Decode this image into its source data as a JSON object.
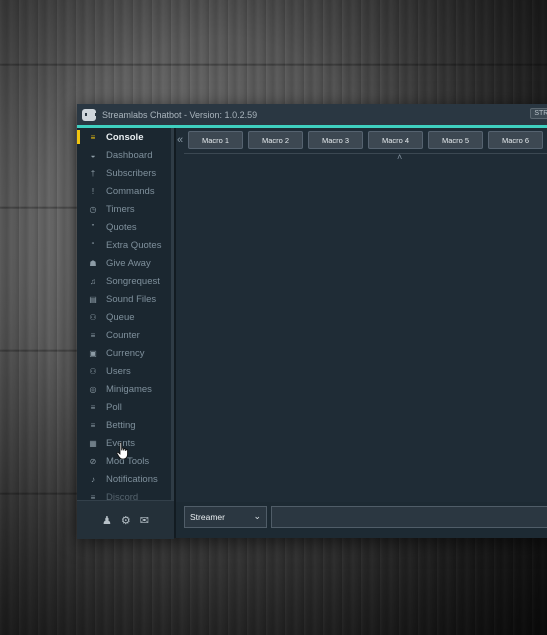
{
  "window": {
    "title": "Streamlabs Chatbot - Version: 1.0.2.59",
    "corner_badge": "STRE"
  },
  "sidebar": {
    "items": [
      {
        "label": "Console",
        "icon": "list-icon",
        "glyph": "≡",
        "active": true
      },
      {
        "label": "Dashboard",
        "icon": "dashboard-icon",
        "glyph": "◒"
      },
      {
        "label": "Subscribers",
        "icon": "person-icon",
        "glyph": "†"
      },
      {
        "label": "Commands",
        "icon": "exclamation-icon",
        "glyph": "!"
      },
      {
        "label": "Timers",
        "icon": "clock-icon",
        "glyph": "◷"
      },
      {
        "label": "Quotes",
        "icon": "quote-close-icon",
        "glyph": "”"
      },
      {
        "label": "Extra Quotes",
        "icon": "quote-open-icon",
        "glyph": "“"
      },
      {
        "label": "Give Away",
        "icon": "gift-icon",
        "glyph": "☗"
      },
      {
        "label": "Songrequest",
        "icon": "music-icon",
        "glyph": "♫"
      },
      {
        "label": "Sound Files",
        "icon": "file-audio-icon",
        "glyph": "▤"
      },
      {
        "label": "Queue",
        "icon": "users-icon",
        "glyph": "⚇"
      },
      {
        "label": "Counter",
        "icon": "list-icon",
        "glyph": "≡"
      },
      {
        "label": "Currency",
        "icon": "money-icon",
        "glyph": "▣"
      },
      {
        "label": "Users",
        "icon": "users-icon",
        "glyph": "⚇"
      },
      {
        "label": "Minigames",
        "icon": "gamepad-icon",
        "glyph": "◎"
      },
      {
        "label": "Poll",
        "icon": "list-icon",
        "glyph": "≡"
      },
      {
        "label": "Betting",
        "icon": "list-icon",
        "glyph": "≡"
      },
      {
        "label": "Events",
        "icon": "calendar-icon",
        "glyph": "▦"
      },
      {
        "label": "Mod Tools",
        "icon": "ban-icon",
        "glyph": "⊘"
      },
      {
        "label": "Notifications",
        "icon": "bell-icon",
        "glyph": "♪"
      },
      {
        "label": "Discord",
        "icon": "list-icon",
        "glyph": "≡",
        "cut": true
      }
    ],
    "footer": [
      {
        "icon": "user-icon",
        "glyph": "♟"
      },
      {
        "icon": "gear-icon",
        "glyph": "⚙"
      },
      {
        "icon": "envelope-icon",
        "glyph": "✉"
      }
    ]
  },
  "macros": [
    "Macro 1",
    "Macro 2",
    "Macro 3",
    "Macro 4",
    "Macro 5",
    "Macro 6"
  ],
  "collapse_glyph": "«",
  "caret_glyph": "˄",
  "bottom": {
    "send_as_value": "Streamer",
    "chevron_glyph": "⌄"
  },
  "colors": {
    "accent_teal": "#3fd0c0",
    "active_yellow": "#f1c40f",
    "panel": "#1f2c36"
  }
}
